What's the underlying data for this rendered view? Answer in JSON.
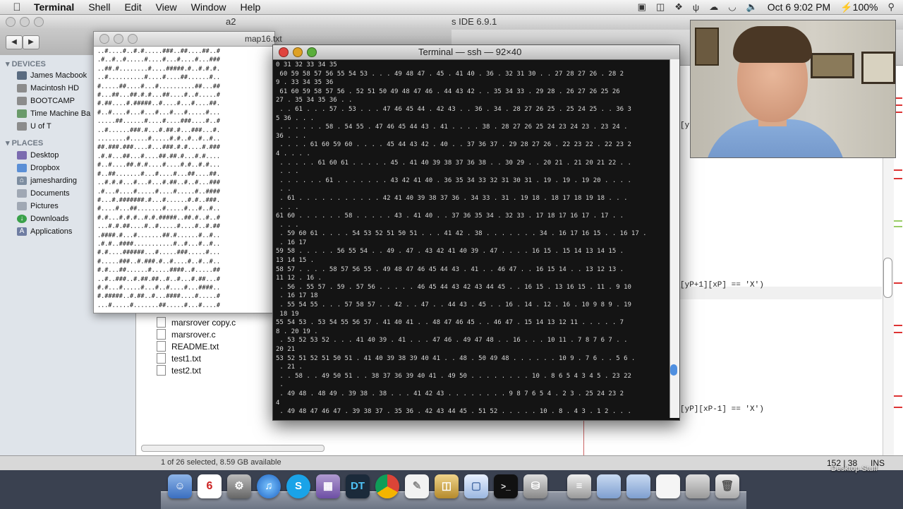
{
  "menubar": {
    "app": "Terminal",
    "items": [
      "Shell",
      "Edit",
      "View",
      "Window",
      "Help"
    ],
    "clock": "Oct 6  9:02 PM",
    "battery": "100%"
  },
  "ide": {
    "title": "s IDE 6.9.1",
    "code1": "[yP+1][xP] == 'X')",
    "code2": "[yP][xP-1] == 'X')",
    "code0": "[yP",
    "cursor_pos": "152 | 38",
    "mode": "INS"
  },
  "finder": {
    "title": "a2",
    "sidebar": {
      "devices_header": "DEVICES",
      "devices": [
        "James Macbook",
        "Macintosh HD",
        "BOOTCAMP",
        "Time Machine Ba",
        "U of T"
      ],
      "places_header": "PLACES",
      "places": [
        "Desktop",
        "Dropbox",
        "jamesharding",
        "Documents",
        "Pictures",
        "Downloads",
        "Applications"
      ]
    },
    "files": [
      "marsrover copy.c",
      "marsrover.c",
      "README.txt",
      "test1.txt",
      "test2.txt"
    ],
    "status": "1 of 26 selected, 8.59 GB available"
  },
  "map": {
    "title": "map16.txt",
    "lines": [
      "..#....#..#.#.....###..##....##..#",
      ".#..#..#.....#....#...#....#...###",
      "..##.#........#....#####.#..#.#.#.",
      "..#..........#....#....##......#..",
      "#.....##....#...#..........##...##",
      "#...##...##.#.#...##....#..#.....#",
      "#.##....#.#####..#....#...#....##.",
      "#..#....#...#...#...#...#.....#...",
      ".....##......#....#....###....#..#",
      "..#......###.#...#.##.#...###...#.",
      "........#.....#.....#.#..#..#..#..",
      "##.###.###....#...###.#.#....#.###",
      ".#.#...##...#....##.##.#...#.#....",
      "#..#....##.#.#....#....#.#..#.#...",
      "#..##.......#...#....#...##....##.",
      "..#.#.#...#...#...#.##..#..#...###",
      ".#...#....#.....#....#.....#..####",
      "#...#.#######.#...#......#.#..###.",
      "#....#...##.......#.....#...#..#..",
      "#.#...#.#.#..#.#.#####..##.#..#..#",
      "...#.#.##....#..#.....#....#..#.##",
      ".####.#...#.......##.#......#..#..",
      ".#.#..####...........#..#...#..#..",
      "#.#....######...#.....###.....#...",
      "#.....###..#.###.#..#....#..#..#..",
      "#.#...##......#.....####..#.....##",
      "..#..###..#.##.##..#..#...#.##...#",
      "#.#...#.....#...#..#....#...####..",
      "#.#####..#.##..#...####....#.....#",
      "...#.....#.......##.....#...#....#",
      "#..#.#..#..###.#...#.#.#..###..#..",
      "#..#####.#.##.#....#..#...#..####.",
      "#.##...#..#.#..#.###..#.#...##.#..",
      "#.#....#...#..##...#..#.##.###.#.#",
      "#..#...##.#....#..#.#...##...#....",
      "#..##....#..#.##..#.#..#.#.#.#...#"
    ]
  },
  "terminal": {
    "title": "Terminal — ssh — 92×40",
    "lines": [
      "0 31 32 33 34 35",
      " 60 59 58 57 56 55 54 53 . . . 49 48 47 . 45 . 41 40 . 36 . 32 31 30 . . 27 28 27 26 . 28 2",
      "9 . 33 34 35 36",
      " 61 60 59 58 57 56 . 52 51 50 49 48 47 46 . 44 43 42 . . 35 34 33 . 29 28 . 26 27 26 25 26",
      "27 . 35 34 35 36 . .",
      " . . 61 . . . 57 . 53 . . . 47 46 45 44 . 42 43 . . 36 . 34 . 28 27 26 25 . 25 24 25 . . 36 3",
      "5 36 . . .",
      " . . . . . . 58 . 54 55 . 47 46 45 44 43 . 41 . . . . 38 . 28 27 26 25 24 23 24 23 . 23 24 .",
      "36 . . .",
      " . . . . 61 60 59 60 . . . . 45 44 43 42 . 40 . . 37 36 37 . 29 28 27 26 . 22 23 22 . 22 23 2",
      "4 . . . .",
      " . . . . . 61 60 61 . . . . . 45 . 41 40 39 38 37 36 38 . . 30 29 . . 20 21 . 21 20 21 22 . .",
      " . . .",
      " . . . . . . 61 . . . . . . . 43 42 41 40 . 36 35 34 33 32 31 30 31 . 19 . 19 . 19 20 . . . .",
      " . .",
      " . 61 . . . . . . . . . . . 42 41 40 39 38 37 36 . 34 33 . 31 . 19 18 . 18 17 18 19 18 . . .",
      " . . .",
      "61 60 . . . . . . 58 . . . . . 43 . 41 40 . . 37 36 35 34 . 32 33 . 17 18 17 16 17 . 17 . .",
      " . . .",
      " . 59 60 61 . . . . 54 53 52 51 50 51 . . . 41 42 . 38 . . . . . . . 34 . 16 17 16 15 . . 16 17 .",
      " . 16 17",
      "59 58 . . . . . 56 55 54 . . 49 . 47 . 43 42 41 40 39 . 47 . . . . 16 15 . 15 14 13 14 15 .",
      "13 14 15 .",
      "58 57 . . . . 58 57 56 55 . 49 48 47 46 45 44 43 . 41 . . 46 47 . . 16 15 14 . . 13 12 13 .",
      "11 12 . 16 .",
      " . 56 . 55 57 . 59 . 57 56 . . . . . 46 45 44 43 42 43 44 45 . . 16 15 . 13 16 15 . 11 . 9 10",
      " . 16 17 18",
      " . 55 54 55 . . . 57 58 57 . . 42 . . 47 . . 44 43 . 45 . . 16 . 14 . 12 . 16 . 10 9 8 9 . 19",
      " 18 19",
      "55 54 53 . 53 54 55 56 57 . 41 40 41 . . 48 47 46 45 . . 46 47 . 15 14 13 12 11 . . . . . 7",
      "8 . 20 19 .",
      " . 53 52 53 52 . . . 41 40 39 . 41 . . . 47 46 . 49 47 48 . . 16 . . . 10 11 . 7 8 7 6 7 . .",
      "20 21",
      "53 52 51 52 51 50 51 . 41 40 39 38 39 40 41 . . 48 . 50 49 48 . . . . . . 10 9 . 7 6 . . 5 6 .",
      " . 21 .",
      " . . 58 . . 49 50 51 . . 38 37 36 39 40 41 . 49 50 . . . . . . . . 10 . 8 6 5 4 3 4 5 . 23 22",
      " .",
      " . 49 48 . 48 49 . 39 38 . 38 . . . 41 42 43 . . . . . . . . 9 8 7 6 5 4 . 2 3 . 25 24 23 2",
      "4",
      " . 49 48 47 46 47 . 39 38 37 . 35 36 . 42 43 44 45 . 51 52 . . . . . 10 . 8 . 4 3 . 1 2 . . ."
    ]
  },
  "dock": {
    "calendar_day": "6",
    "dt_label": "DT",
    "desktop_stuff": "Desktop Stuff"
  },
  "icons": [
    "apple-icon",
    "wifi-icon",
    "volume-icon",
    "battery-icon",
    "search-icon",
    "trash-icon",
    "finder-icon",
    "chrome-icon",
    "itunes-icon",
    "skype-icon",
    "terminal-icon"
  ]
}
